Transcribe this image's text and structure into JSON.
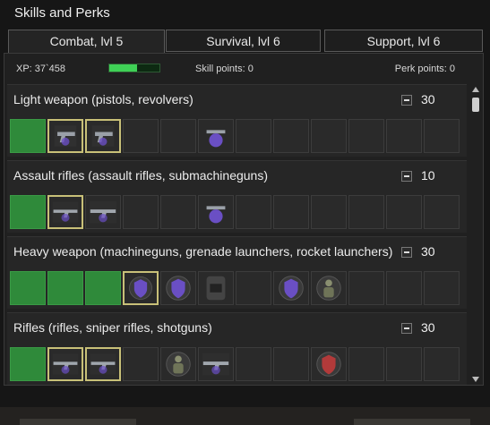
{
  "window": {
    "title": "Skills and Perks"
  },
  "tabs": [
    {
      "label": "Combat, lvl 5",
      "active": true
    },
    {
      "label": "Survival, lvl 6",
      "active": false
    },
    {
      "label": "Support, lvl 6",
      "active": false
    }
  ],
  "status": {
    "xp": "XP: 37`458",
    "xp_progress": 0.55,
    "skill_points": "Skill points: 0",
    "perk_points": "Perk points: 0"
  },
  "colors": {
    "accent_green": "#2f8a3a",
    "xp_green": "#3fd156",
    "perk_purple": "#6a4fc4",
    "perk_red": "#b23a3a",
    "selected_border": "#c8c078"
  },
  "skills": [
    {
      "name": "Light weapon (pistols, revolvers)",
      "level": "30",
      "slots": [
        "filled",
        "pistol-perk-icon",
        "pistol-selected-icon",
        "empty",
        "empty",
        "purple-perk-icon",
        "empty",
        "empty",
        "empty",
        "empty",
        "empty",
        "empty"
      ]
    },
    {
      "name": "Assault rifles (assault rifles, submachineguns)",
      "level": "10",
      "slots": [
        "filled",
        "rifle-perk-icon",
        "rifle-icon",
        "empty",
        "empty",
        "purple-perk-icon",
        "empty",
        "empty",
        "empty",
        "empty",
        "empty",
        "empty"
      ]
    },
    {
      "name": "Heavy weapon (machineguns, grenade launchers, rocket launchers)",
      "level": "30",
      "slots": [
        "filled",
        "filled",
        "filled",
        "purple-shield-icon",
        "purple-shield-icon",
        "badge-25-icon",
        "empty",
        "purple-shield-icon",
        "soldier-icon",
        "empty",
        "empty",
        "empty"
      ]
    },
    {
      "name": "Rifles (rifles, sniper rifles, shotguns)",
      "level": "30",
      "slots": [
        "filled",
        "rifle-perk-icon",
        "rifle-selected-icon",
        "empty",
        "soldier-icon",
        "rifle-perk-icon",
        "empty",
        "empty",
        "red-shield-icon",
        "empty",
        "empty",
        "empty"
      ]
    }
  ]
}
